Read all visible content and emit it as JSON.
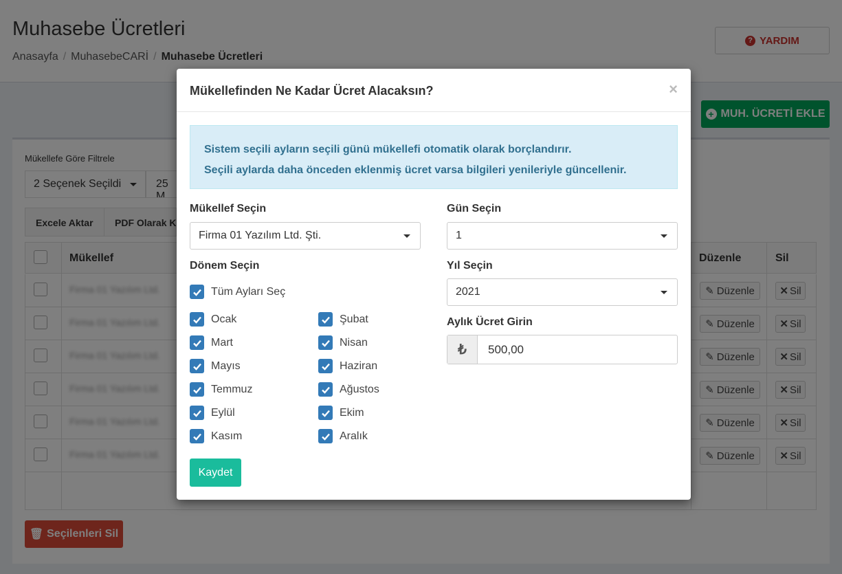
{
  "page": {
    "title": "Muhasebe Ücretleri",
    "breadcrumb": [
      "Anasayfa",
      "MuhasebeCARİ",
      "Muhasebe Ücretleri"
    ],
    "help_label": "YARDIM",
    "add_label": "MUH. ÜCRETİ EKLE",
    "filter_label": "Mükellefe Göre Filtrele",
    "filter_value": "2 Seçenek Seçildi",
    "filter_value2": "25 M",
    "export_buttons": [
      "Excele Aktar",
      "PDF Olarak K"
    ],
    "table_headers": {
      "taxpayer": "Mükellef",
      "edit": "Düzenle",
      "delete": "Sil"
    },
    "row_blur_text": "Firma 01 Yazılım Ltd.",
    "row_edit": "Düzenle",
    "row_delete": "Sil",
    "delete_selected": "Seçilenleri Sil"
  },
  "modal": {
    "title": "Mükellefinden Ne Kadar Ücret Alacaksın?",
    "close": "×",
    "alert_line1": "Sistem seçili ayların seçili günü mükellefi otomatik olarak borçlandırır.",
    "alert_line2": "Seçili aylarda daha önceden eklenmiş ücret varsa bilgileri yenileriyle güncellenir.",
    "taxpayer_label": "Mükellef Seçin",
    "taxpayer_value": "Firma 01 Yazılım Ltd. Şti.",
    "period_label": "Dönem Seçin",
    "select_all": "Tüm Ayları Seç",
    "months": [
      "Ocak",
      "Şubat",
      "Mart",
      "Nisan",
      "Mayıs",
      "Haziran",
      "Temmuz",
      "Ağustos",
      "Eylül",
      "Ekim",
      "Kasım",
      "Aralık"
    ],
    "day_label": "Gün Seçin",
    "day_value": "1",
    "year_label": "Yıl Seçin",
    "year_value": "2021",
    "fee_label": "Aylık Ücret Girin",
    "currency_symbol": "₺",
    "fee_value": "500,00",
    "save_label": "Kaydet"
  },
  "colors": {
    "primary": "#337ab7",
    "success": "#00a65a",
    "danger": "#dd4b39",
    "info_bg": "#d9edf7",
    "save": "#1abc9c"
  }
}
